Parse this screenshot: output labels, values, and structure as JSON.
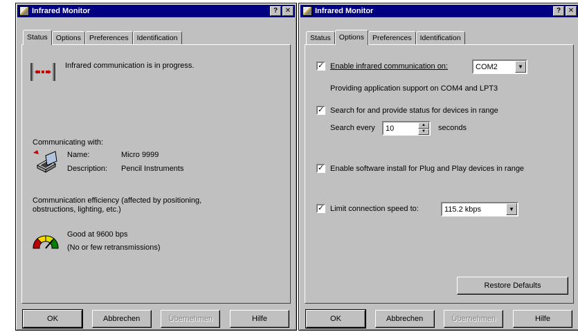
{
  "left": {
    "title": "Infrared Monitor",
    "tabs": [
      "Status",
      "Options",
      "Preferences",
      "Identification"
    ],
    "status_message": "Infrared communication is in progress.",
    "communicating_with": "Communicating with:",
    "name_label": "Name:",
    "name_value": "Micro 9999",
    "description_label": "Description:",
    "description_value": "Pencil Instruments",
    "efficiency_heading": "Communication efficiency (affected by positioning, obstructions, lighting, etc.)",
    "efficiency_value": "Good at 9600 bps",
    "efficiency_note": "(No or few retransmissions)",
    "buttons": {
      "ok": "OK",
      "cancel": "Abbrechen",
      "apply": "Übernehmen",
      "help": "Hilfe"
    }
  },
  "right": {
    "title": "Infrared Monitor",
    "tabs": [
      "Status",
      "Options",
      "Preferences",
      "Identification"
    ],
    "enable_ir_label": "Enable infrared communication on:",
    "enable_ir_checked": true,
    "port_value": "COM2",
    "support_text": "Providing application support on COM4 and LPT3",
    "search_label": "Search for and provide status for devices in range",
    "search_checked": true,
    "search_every_label": "Search every",
    "search_every_value": "10",
    "seconds_label": "seconds",
    "plug_play_label": "Enable software install for Plug and Play devices in range",
    "plug_play_checked": true,
    "limit_speed_label": "Limit connection speed to:",
    "limit_speed_checked": true,
    "speed_value": "115.2 kbps",
    "restore_defaults": "Restore Defaults",
    "buttons": {
      "ok": "OK",
      "cancel": "Abbrechen",
      "apply": "Übernehmen",
      "help": "Hilfe"
    }
  },
  "icons": {
    "help": "question-icon",
    "close": "close-x-icon",
    "app": "infrared-monitor-icon",
    "ir_beam": "infrared-beam-icon",
    "laptop": "laptop-icon",
    "gauge": "signal-gauge-icon"
  },
  "colors": {
    "titlebar": "#000080",
    "face": "#c0c0c0",
    "ir_red": "#c00000"
  }
}
